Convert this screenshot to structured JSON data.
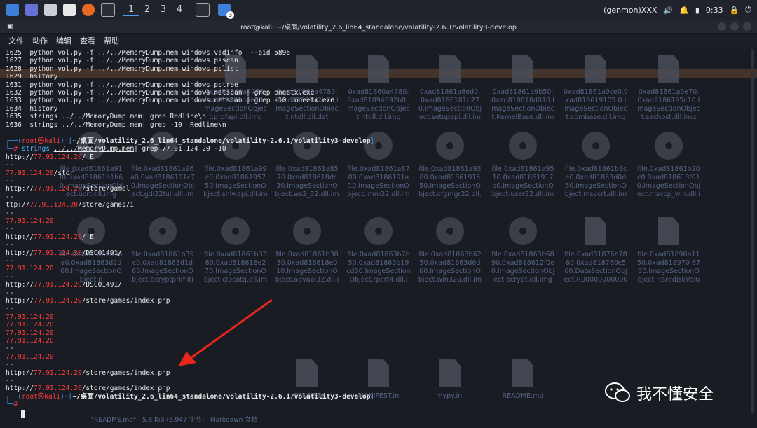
{
  "topbar": {
    "workspaces": [
      "1",
      "2",
      "3",
      "4"
    ],
    "active_workspace": "1",
    "badge": "3",
    "genmon": "(genmon)XXX",
    "clock": "0:33"
  },
  "terminal": {
    "title": "root@kali: ~/桌面/volatility_2.6_lin64_standalone/volatility-2.6.1/volatility3-develop",
    "menu": [
      "文件",
      "动作",
      "编辑",
      "查看",
      "帮助"
    ],
    "history": [
      {
        "num": "1625",
        "cmd": "python vol.py -f ../../MemoryDump.mem windows.vadinfo  --pid 5896"
      },
      {
        "num": "1627",
        "cmd": "python vol.py -f ../../MemoryDump.mem windows.psscan"
      },
      {
        "num": "1628",
        "cmd": "python vol.py -f ../../MemoryDump.mem windows.pslist"
      },
      {
        "num": "1629",
        "cmd": "hsitory"
      },
      {
        "num": "1631",
        "cmd": "python vol.py -f ../../MemoryDump.mem windows.pstree"
      },
      {
        "num": "1632",
        "cmd": "python vol.py -f ../../MemoryDump.mem windows.netscan | grep oneetx.exe"
      },
      {
        "num": "1633",
        "cmd": "python vol.py -f ../../MemoryDump.mem windows.netscan | grep -10  oneetx.exe"
      },
      {
        "num": "1634",
        "cmd": "history"
      },
      {
        "num": "1635",
        "cmd": "strings ../../MemoryDump.mem| grep Redline\\n"
      },
      {
        "num": "1636",
        "cmd": "strings ../../MemoryDump.mem| grep -10  Redline\\n"
      }
    ],
    "prompt_user": "root㉿kali",
    "prompt_path": "~/桌面/volatility_2.6_lin64_standalone/volatility-2.6.1/volatility3-develop",
    "command": {
      "prefix": "strings ",
      "file": "../../MemoryDump.mem",
      "suffix": "| grep 77.91.124.20 -10"
    },
    "output": [
      {
        "pre": "http://",
        "ip": "77.91.124.20",
        "post": "/ E"
      },
      {
        "pre": "--",
        "ip": "",
        "post": ""
      },
      {
        "pre": "",
        "ip": "77.91.124.20",
        "post": "/stor"
      },
      {
        "pre": "--",
        "ip": "",
        "post": ""
      },
      {
        "pre": "http://",
        "ip": "77.91.124.20",
        "post": "/store/gamel"
      },
      {
        "pre": "--",
        "ip": "",
        "post": ""
      },
      {
        "pre": "ttp://",
        "ip": "77.91.124.20",
        "post": "/store/games/i"
      },
      {
        "pre": "--",
        "ip": "",
        "post": ""
      },
      {
        "pre": "",
        "ip": "77.91.124.20",
        "post": ""
      },
      {
        "pre": "--",
        "ip": "",
        "post": ""
      },
      {
        "pre": "http://",
        "ip": "77.91.124.20",
        "post": "/ E"
      },
      {
        "pre": "--",
        "ip": "",
        "post": ""
      },
      {
        "pre": "http://",
        "ip": "77.91.124.20",
        "post": "/DSC01491/"
      },
      {
        "pre": "--",
        "ip": "",
        "post": ""
      },
      {
        "pre": "",
        "ip": "77.91.124.20",
        "post": ""
      },
      {
        "pre": "--",
        "ip": "",
        "post": ""
      },
      {
        "pre": "http://",
        "ip": "77.91.124.20",
        "post": "/DSC01491/"
      },
      {
        "pre": "--",
        "ip": "",
        "post": ""
      },
      {
        "pre": "http://",
        "ip": "77.91.124.20",
        "post": "/store/games/index.php"
      },
      {
        "pre": "--",
        "ip": "",
        "post": ""
      },
      {
        "pre": "",
        "ip": "77.91.124.20",
        "post": ""
      },
      {
        "pre": "",
        "ip": "77.91.124.20",
        "post": ""
      },
      {
        "pre": "",
        "ip": "77.91.124.20",
        "post": ""
      },
      {
        "pre": "",
        "ip": "77.91.124.20",
        "post": ""
      },
      {
        "pre": "--",
        "ip": "",
        "post": ""
      },
      {
        "pre": "",
        "ip": "77.91.124.20",
        "post": ""
      },
      {
        "pre": "--",
        "ip": "",
        "post": ""
      },
      {
        "pre": "http://",
        "ip": "77.91.124.20",
        "post": "/store/games/index.php"
      },
      {
        "pre": "--",
        "ip": "",
        "post": ""
      },
      {
        "pre": "http://",
        "ip": "77.91.124.20",
        "post": "/store/games/index.php"
      }
    ]
  },
  "background_files": [
    {
      "label": "0xad81860a4780.0xad81861b4e70.ImageSectionObject.profapi.dll.img",
      "icon": "doc"
    },
    {
      "label": "0xad81860a4780.0xad81861d2b70.ImageSectionObject.ntdll.dll.dat",
      "icon": "doc"
    },
    {
      "label": "0xad81860a4780.0xad81894692b0.ImageSectionObject.ntdll.dll.img",
      "icon": "doc"
    },
    {
      "label": "0xad81861a8ed0.0xad8186181d270.ImageSectionObject.setupapi.dll.img",
      "icon": "doc"
    },
    {
      "label": "0xad81861a9b50.0xad818618d010.ImageSectionObject.KernelBase.dll.img",
      "icon": "doc"
    },
    {
      "label": "0xad81861a9ce0.0xad818619105 0.ImageSectionObject.combase.dll.img",
      "icon": "doc"
    },
    {
      "label": "0xad81861a9e70.0xad8186195c10.ImageSectionObject.sechost.dll.img",
      "icon": "doc"
    },
    {
      "label": "file.0xad81861a91f0.0xad81861b1b60.ImageSectionObject.ucrt.dll.img",
      "icon": "disc"
    },
    {
      "label": "file.0xad81861a96a0.0xad8186191c70.ImageSectionObject.gdi32full.dll.img",
      "icon": "disc"
    },
    {
      "label": "file.0xad81861a99c0.0xad8186195750.ImageSectionObject.shlwapi.dll.img",
      "icon": "disc"
    },
    {
      "label": "file.0xad81861a8570.0xad818618dc30.ImageSectionObject.ws2_32.dll.img",
      "icon": "disc"
    },
    {
      "label": "file.0xad81861a8700.0xad8186191a10.ImageSectionObject.imm32.dll.img",
      "icon": "disc"
    },
    {
      "label": "file.0xad81861a9380.0xad8186191550.ImageSectionObject.cfgmgr32.dll.img",
      "icon": "disc"
    },
    {
      "label": "file.0xad81861a9510.0xad81861917b0.ImageSectionObject.user32.dll.img",
      "icon": "disc"
    },
    {
      "label": "file.0xad81861b3ce0.0xad81863d0d60.ImageSectionObject.msvcrt.dll.img",
      "icon": "disc"
    },
    {
      "label": "file.0xad81861b20c0.0xad818618f010.ImageSectionObject.msvcp_win.dll.img",
      "icon": "disc"
    },
    {
      "label": "file.0xad81861b36a0.0xad81863d2d60.ImageSectionObject.n",
      "icon": "disc"
    },
    {
      "label": "file.0xad81861b39c0.0xad81863d1d60.ImageSectionObject.bcryptprimitives.dll.img",
      "icon": "disc"
    },
    {
      "label": "file.0xad81861b3380.0xad818618e270.ImageSectionObject.clbcatq.dll.img",
      "icon": "disc"
    },
    {
      "label": "file.0xad81861b3830.0xad818618e010.ImageSectionObject.advapi32.dll.img",
      "icon": "disc"
    },
    {
      "label": "file.0xad81863b7b50.0xad81863b19cd30.ImageSectionObject.rpcrt4.dll.img",
      "icon": "disc"
    },
    {
      "label": "file.0xad81863b6250.0xad81863d6d60.ImageSectionObject.win32u.dll.img",
      "icon": "disc"
    },
    {
      "label": "file.0xad81863b6890.0xad818612f0e0.ImageSectionObject.bcrypt.dll.img",
      "icon": "disc"
    },
    {
      "label": "file.0xad81876b7860.0xad818760c560.DataSectionObject.R000000000006.clb.dat",
      "icon": "doc"
    },
    {
      "label": "file.0xad81898a1150.0xad818970 6730.ImageSectionObject.HarddiskVolume.img",
      "icon": "doc"
    }
  ],
  "bottom_files": [
    {
      "label": "LICENSE.txt",
      "icon": "doc"
    },
    {
      "label": "MANIFEST.in",
      "icon": "doc"
    },
    {
      "label": "mypy.ini",
      "icon": "doc"
    },
    {
      "label": "README.md",
      "icon": "doc"
    }
  ],
  "footer_status": "\"README.md\" | 5.8 KiB (5,947 字节) | Markdown 文档",
  "watermark": "我不懂安全",
  "colors": {
    "ip_highlight": "#ff3b3b",
    "prompt": "#3b8eea",
    "arrow": "#e8261b"
  }
}
